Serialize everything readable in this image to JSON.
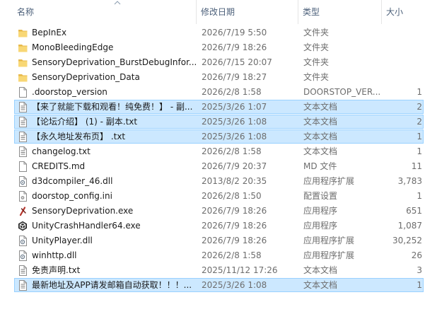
{
  "columns": {
    "name": "名称",
    "date": "修改日期",
    "type": "类型",
    "size": "大小"
  },
  "files": [
    {
      "name": "BepInEx",
      "date": "2026/7/19 5:50",
      "type": "文件夹",
      "size": "",
      "icon": "folder-icon",
      "selected": false
    },
    {
      "name": "MonoBleedingEdge",
      "date": "2026/7/9 18:26",
      "type": "文件夹",
      "size": "",
      "icon": "folder-icon",
      "selected": false
    },
    {
      "name": "SensoryDeprivation_BurstDebugInfor...",
      "date": "2026/7/15 20:07",
      "type": "文件夹",
      "size": "",
      "icon": "folder-icon",
      "selected": false
    },
    {
      "name": "SensoryDeprivation_Data",
      "date": "2026/7/9 18:27",
      "type": "文件夹",
      "size": "",
      "icon": "folder-icon",
      "selected": false
    },
    {
      "name": ".doorstop_version",
      "date": "2026/2/8 1:58",
      "type": "DOORSTOP_VER...",
      "size": "1",
      "icon": "blank-file-icon",
      "selected": false
    },
    {
      "name": "【来了就能下载和观看！纯免费！】 - 副...",
      "date": "2025/3/26 1:07",
      "type": "文本文档",
      "size": "2",
      "icon": "text-file-icon",
      "selected": true
    },
    {
      "name": "【论坛介绍】 (1) - 副本.txt",
      "date": "2025/3/26 1:08",
      "type": "文本文档",
      "size": "2",
      "icon": "text-file-icon",
      "selected": true
    },
    {
      "name": "【永久地址发布页】 .txt",
      "date": "2025/3/26 1:08",
      "type": "文本文档",
      "size": "1",
      "icon": "text-file-icon",
      "selected": true
    },
    {
      "name": "changelog.txt",
      "date": "2026/2/8 1:58",
      "type": "文本文档",
      "size": "1",
      "icon": "text-file-icon",
      "selected": false
    },
    {
      "name": "CREDITS.md",
      "date": "2026/7/9 20:37",
      "type": "MD 文件",
      "size": "11",
      "icon": "blank-file-icon",
      "selected": false
    },
    {
      "name": "d3dcompiler_46.dll",
      "date": "2013/8/2 20:35",
      "type": "应用程序扩展",
      "size": "3,783",
      "icon": "dll-file-icon",
      "selected": false
    },
    {
      "name": "doorstop_config.ini",
      "date": "2026/2/8 1:50",
      "type": "配置设置",
      "size": "1",
      "icon": "config-file-icon",
      "selected": false
    },
    {
      "name": "SensoryDeprivation.exe",
      "date": "2026/7/9 18:26",
      "type": "应用程序",
      "size": "651",
      "icon": "game-exe-icon",
      "selected": false
    },
    {
      "name": "UnityCrashHandler64.exe",
      "date": "2026/7/9 18:26",
      "type": "应用程序",
      "size": "1,087",
      "icon": "unity-exe-icon",
      "selected": false
    },
    {
      "name": "UnityPlayer.dll",
      "date": "2026/7/9 18:26",
      "type": "应用程序扩展",
      "size": "30,252",
      "icon": "dll-file-icon",
      "selected": false
    },
    {
      "name": "winhttp.dll",
      "date": "2026/2/8 1:58",
      "type": "应用程序扩展",
      "size": "26",
      "icon": "dll-file-icon",
      "selected": false
    },
    {
      "name": "免责声明.txt",
      "date": "2025/11/12 17:26",
      "type": "文本文档",
      "size": "3",
      "icon": "text-file-icon",
      "selected": false
    },
    {
      "name": "最新地址及APP请发邮箱自动获取！！！...",
      "date": "2025/3/26 1:08",
      "type": "文本文档",
      "size": "1",
      "icon": "text-file-icon",
      "selected": true
    }
  ],
  "colors": {
    "selection_bg": "#cce8ff",
    "selection_border": "#99d1ff",
    "header_text": "#4c607a",
    "folder": "#f8d775"
  }
}
